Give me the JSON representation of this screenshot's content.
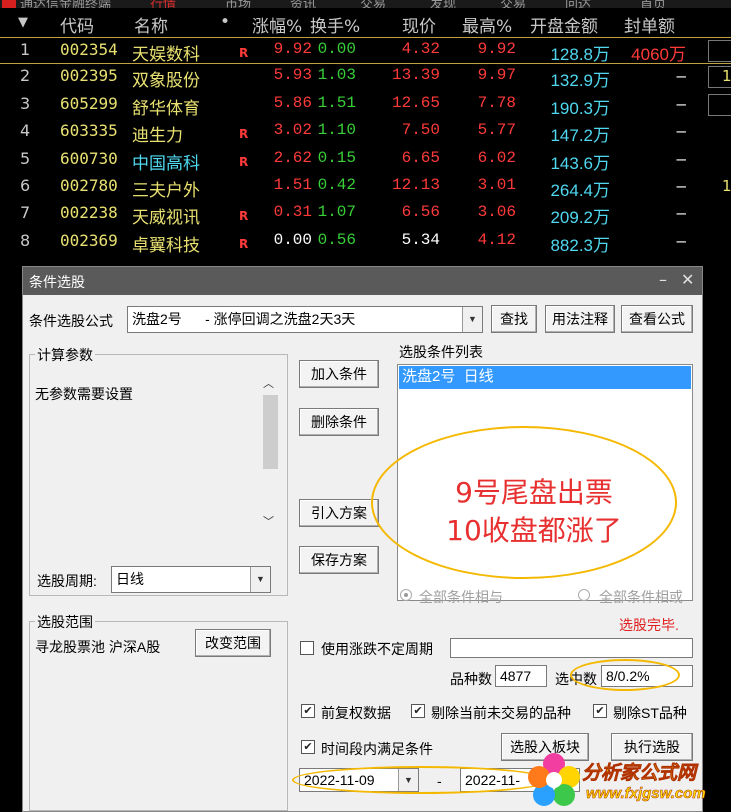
{
  "top_menu": [
    "通达信金融终端",
    "行情",
    "市场",
    "资讯",
    "交易",
    "发现",
    "交易",
    "问达",
    "首页"
  ],
  "grid": {
    "sort_marker": "▼",
    "headers": [
      "代码",
      "名称",
      "•",
      "涨幅%",
      "换手%",
      "现价",
      "最高%",
      "开盘金额",
      "封单额"
    ],
    "rows": [
      {
        "idx": "1",
        "code": "002354",
        "name": "天娱数科",
        "flag": "R",
        "chg": "9.92",
        "turn": "0.00",
        "price": "4.32",
        "high": "9.92",
        "open_amt": "128.8万",
        "seal": "4060万",
        "edge": ""
      },
      {
        "idx": "2",
        "code": "002395",
        "name": "双象股份",
        "flag": "",
        "chg": "5.93",
        "turn": "1.03",
        "price": "13.39",
        "high": "9.97",
        "open_amt": "132.9万",
        "seal": "–",
        "edge": "1"
      },
      {
        "idx": "3",
        "code": "605299",
        "name": "舒华体育",
        "flag": "",
        "chg": "5.86",
        "turn": "1.51",
        "price": "12.65",
        "high": "7.78",
        "open_amt": "190.3万",
        "seal": "–",
        "edge": ""
      },
      {
        "idx": "4",
        "code": "603335",
        "name": "迪生力",
        "flag": "R",
        "chg": "3.02",
        "turn": "1.10",
        "price": "7.50",
        "high": "5.77",
        "open_amt": "147.2万",
        "seal": "–",
        "edge": ""
      },
      {
        "idx": "5",
        "code": "600730",
        "name": "中国高科",
        "flag": "R",
        "chg": "2.62",
        "turn": "0.15",
        "price": "6.65",
        "high": "6.02",
        "open_amt": "143.6万",
        "seal": "–",
        "edge": ""
      },
      {
        "idx": "6",
        "code": "002780",
        "name": "三夫户外",
        "flag": "",
        "chg": "1.51",
        "turn": "0.42",
        "price": "12.13",
        "high": "3.01",
        "open_amt": "264.4万",
        "seal": "–",
        "edge": "1"
      },
      {
        "idx": "7",
        "code": "002238",
        "name": "天威视讯",
        "flag": "R",
        "chg": "0.31",
        "turn": "1.07",
        "price": "6.56",
        "high": "3.06",
        "open_amt": "209.2万",
        "seal": "–",
        "edge": ""
      },
      {
        "idx": "8",
        "code": "002369",
        "name": "卓翼科技",
        "flag": "R",
        "chg": "0.00",
        "turn": "0.56",
        "price": "5.34",
        "high": "4.12",
        "open_amt": "882.3万",
        "seal": "–",
        "edge": ""
      }
    ]
  },
  "dialog": {
    "title": "条件选股",
    "min_glyph": "–",
    "close_glyph": "✕",
    "formula_label": "条件选股公式",
    "formula_value": "洗盘2号      - 涨停回调之洗盘2天3天",
    "btn_search": "查找",
    "btn_usage": "用法注释",
    "btn_view": "查看公式",
    "params_group": "计算参数",
    "params_text": "无参数需要设置",
    "btn_add": "加入条件",
    "btn_delete": "删除条件",
    "btn_import": "引入方案",
    "btn_save": "保存方案",
    "cond_list_title": "选股条件列表",
    "cond_item": "洗盘2号  日线",
    "period_label": "选股周期:",
    "period_value": "日线",
    "radio_and": "全部条件相与",
    "radio_or": "全部条件相或",
    "status": "选股完毕.",
    "range_group": "选股范围",
    "range_text": "寻龙股票池 沪深A股",
    "btn_change_range": "改变范围",
    "chk_var_period": "使用涨跌不定周期",
    "count_label": "品种数",
    "count_value": "4877",
    "selected_label": "选中数",
    "selected_value": "8/0.2%",
    "chk_fq": "前复权数据",
    "chk_exclude_untraded": "剔除当前未交易的品种",
    "chk_exclude_st": "剔除ST品种",
    "chk_time_range": "时间段内满足条件",
    "btn_to_block": "选股入板块",
    "btn_execute": "执行选股",
    "date_from": "2022-11-09",
    "date_sep": "-",
    "date_to": "2022-11-"
  },
  "annotation": {
    "line1": "9号尾盘出票",
    "line2": "10收盘都涨了"
  },
  "watermark": {
    "site": "分析家公式网",
    "url": "www.fxjgsw.com"
  },
  "colors": {
    "rise": "#ff3a3a",
    "fall": "#38d038",
    "name_yellow": "#e8e070",
    "amount_cyan": "#4fd8f0",
    "selection_blue": "#3399ff",
    "annotation_gold": "#f5b800"
  }
}
